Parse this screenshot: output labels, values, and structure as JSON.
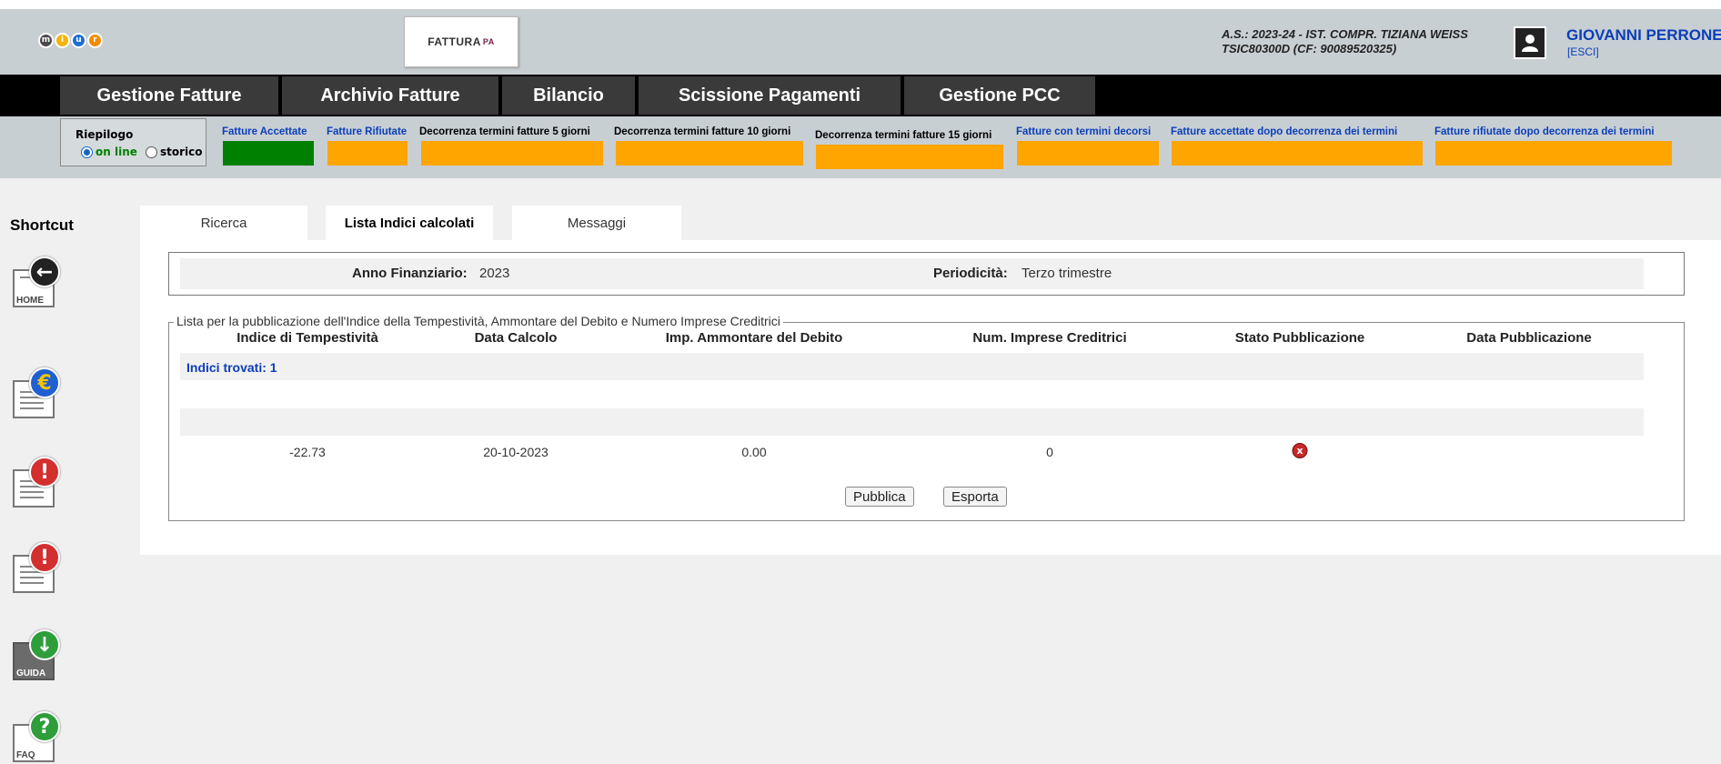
{
  "header": {
    "logo_letters": [
      "m",
      "i",
      "u",
      "r"
    ],
    "logo_colors": [
      "#4a4a4a",
      "#f5b400",
      "#1f6fd1",
      "#f08c00"
    ],
    "fattura_logo_text": "FATTURA",
    "fattura_logo_suffix": "PA",
    "school_line1": "A.S.: 2023-24  - IST. COMPR. TIZIANA WEISS",
    "school_line2": "TSIC80300D  (CF: 90089520325)",
    "user_name": "GIOVANNI PERRONE",
    "logout_label": "[ESCI]"
  },
  "nav": {
    "items": [
      "Gestione Fatture",
      "Archivio Fatture",
      "Bilancio",
      "Scissione Pagamenti",
      "Gestione PCC"
    ]
  },
  "summary": {
    "title": "Riepilogo",
    "options": [
      "on line",
      "storico"
    ],
    "selected": "on line",
    "statuses": [
      {
        "label": "Fatture Accettate",
        "color": "#008000",
        "label_color": "#0b3eb8"
      },
      {
        "label": "Fatture Rifiutate",
        "color": "#ffa500",
        "label_color": "#0b3eb8"
      },
      {
        "label": "Decorrenza termini fatture 5 giorni",
        "color": "#ffa500",
        "label_color": "#000000"
      },
      {
        "label": "Decorrenza termini fatture 10 giorni",
        "color": "#ffa500",
        "label_color": "#000000"
      },
      {
        "label": "Decorrenza termini fatture 15 giorni",
        "color": "#ffa500",
        "label_color": "#000000"
      },
      {
        "label": "Fatture con termini decorsi",
        "color": "#ffa500",
        "label_color": "#0b3eb8"
      },
      {
        "label": "Fatture accettate dopo decorrenza dei termini",
        "color": "#ffa500",
        "label_color": "#0b3eb8"
      },
      {
        "label": "Fatture rifiutate dopo decorrenza dei termini",
        "color": "#ffa500",
        "label_color": "#0b3eb8"
      }
    ]
  },
  "sidebar": {
    "title": "Shortcut",
    "icons": [
      {
        "name": "home",
        "caption": "HOME",
        "glyph": "←",
        "badge_color": "#222222"
      },
      {
        "name": "euro",
        "caption": "",
        "glyph": "€",
        "badge_color": "#1f5fd1"
      },
      {
        "name": "alert",
        "caption": "",
        "glyph": "!",
        "badge_color": "#d32f2f"
      },
      {
        "name": "alert",
        "caption": "",
        "glyph": "!",
        "badge_color": "#d32f2f"
      },
      {
        "name": "guide-download",
        "caption": "GUIDA",
        "glyph": "↓",
        "badge_color": "#2e9e3a"
      },
      {
        "name": "faq",
        "caption": "FAQ",
        "glyph": "?",
        "badge_color": "#2e9e3a"
      }
    ]
  },
  "tabs": [
    "Ricerca",
    "Lista Indici calcolati",
    "Messaggi"
  ],
  "active_tab": "Lista Indici calcolati",
  "filter": {
    "anno_label": "Anno Finanziario:",
    "anno_value": "2023",
    "periodicita_label": "Periodicità:",
    "periodicita_value": "Terzo trimestre"
  },
  "list": {
    "legend": "Lista per la pubblicazione dell'Indice della Tempestività, Ammontare del Debito e Numero Imprese Creditrici",
    "found": "Indici trovati: 1",
    "columns": [
      "Indice di Tempestività",
      "Data Calcolo",
      "Imp. Ammontare del Debito",
      "Num. Imprese Creditrici",
      "Stato Pubblicazione",
      "Data Pubblicazione"
    ],
    "rows": [
      {
        "indice": "-22.73",
        "data_calcolo": "20-10-2023",
        "importo": "0.00",
        "num_imprese": "0",
        "stato_icon": "x",
        "data_pubblicazione": ""
      }
    ],
    "buttons": {
      "pubblica": "Pubblica",
      "esporta": "Esporta"
    }
  }
}
